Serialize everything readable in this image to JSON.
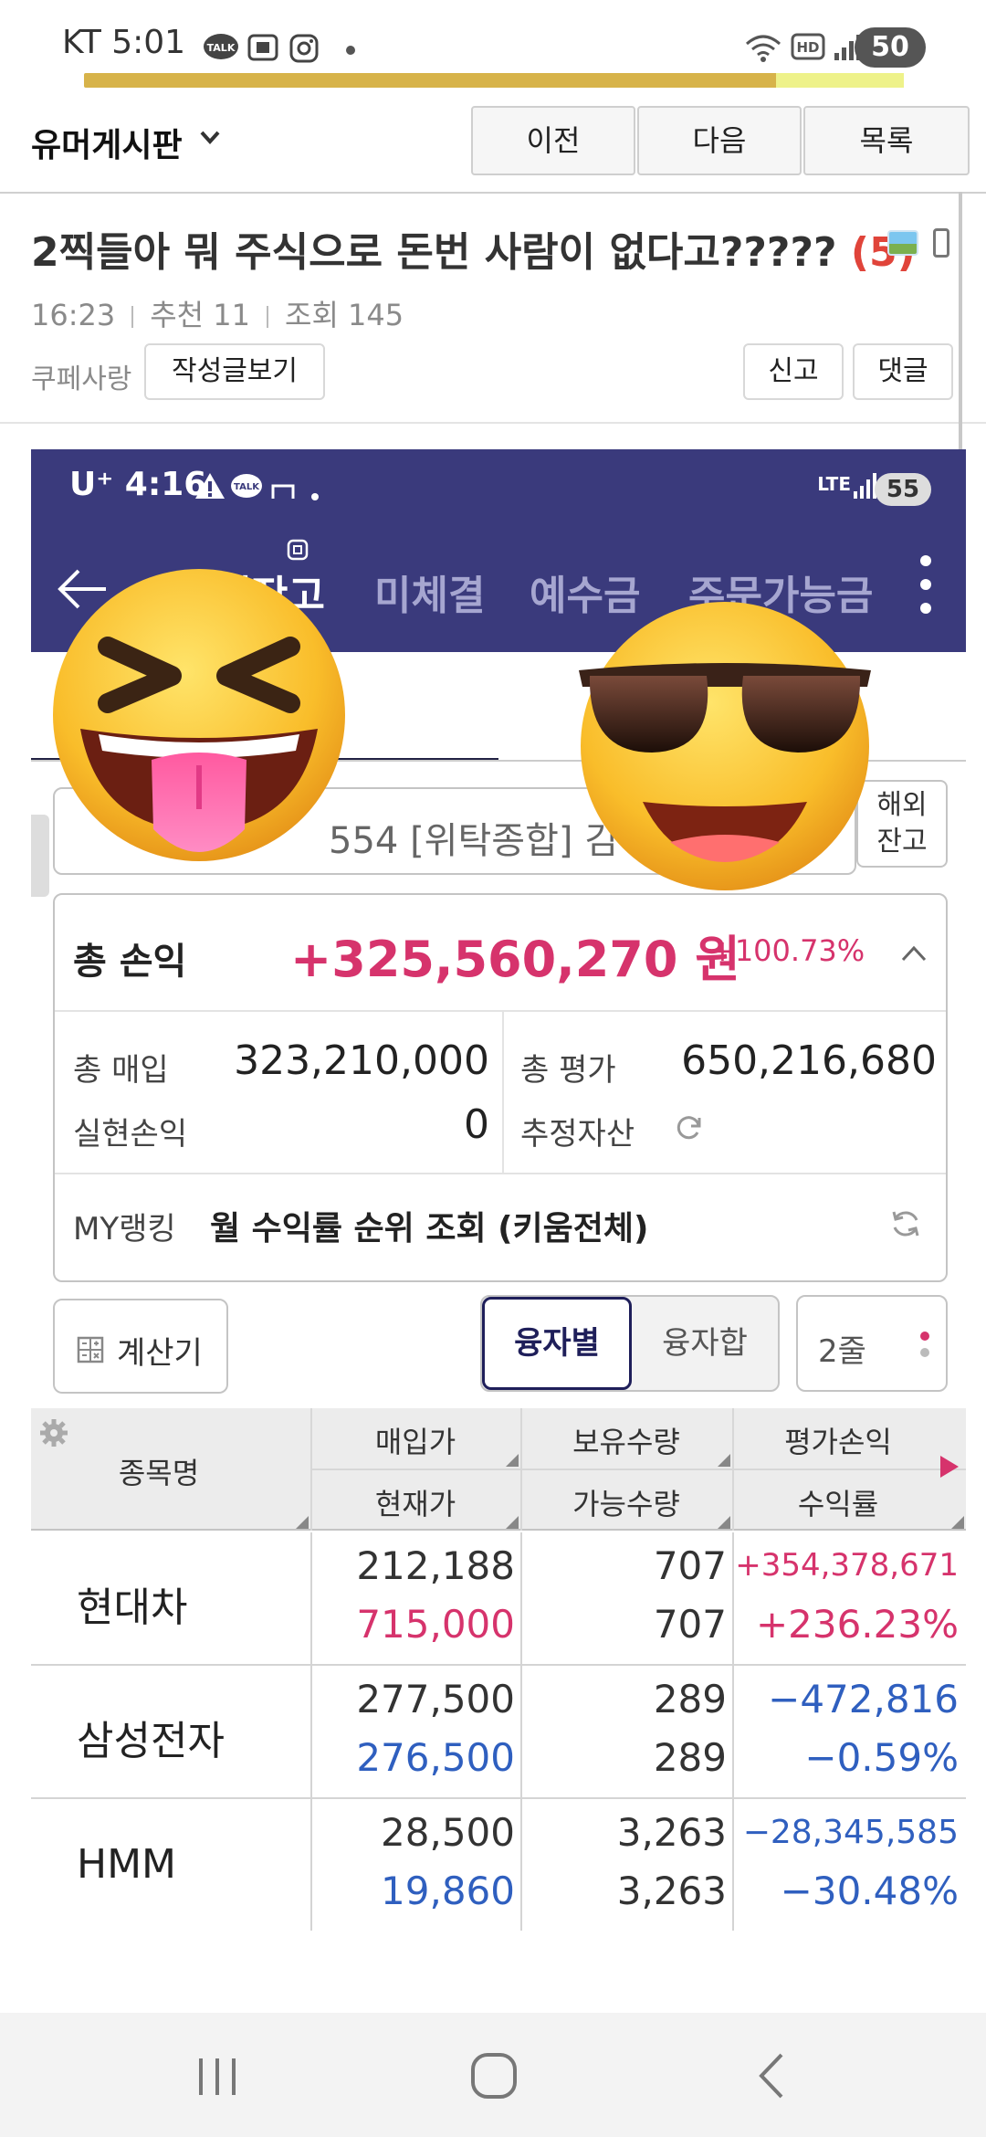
{
  "status_bar": {
    "carrier_time": "KT 5:01",
    "battery": "50"
  },
  "board": {
    "name": "유머게시판",
    "prev_label": "이전",
    "next_label": "다음",
    "list_label": "목록"
  },
  "post": {
    "title": "2찍들아 뭐 주식으로 돈번 사람이 없다고?????",
    "comment_count": "(5)",
    "time": "16:23",
    "likes": "추천 11",
    "views": "조회 145",
    "author": "쿠페사랑",
    "view_posts_label": "작성글보기",
    "report_label": "신고",
    "comment_label": "댓글"
  },
  "screenshot": {
    "status": {
      "carrier_time": "U⁺ 4:16",
      "net": "LTE",
      "battery": "55"
    },
    "tabs": [
      {
        "label": "국내잔고"
      },
      {
        "label": "미체결"
      },
      {
        "label": "예수금"
      },
      {
        "label": "주문가능금"
      }
    ],
    "account": {
      "text": "554 [위탁종합] 김",
      "overseas_label": "해외\n잔고"
    },
    "summary": {
      "total_pl_label": "총 손익",
      "total_pl_value": "+325,560,270 원",
      "total_pl_rate": "+100.73%",
      "purchase_label": "총 매입",
      "purchase_value": "323,210,000",
      "valuation_label": "총 평가",
      "valuation_value": "650,216,680",
      "realized_label": "실현손익",
      "realized_value": "0",
      "estimated_label": "추정자산",
      "ranking_label": "MY랭킹",
      "ranking_text": "월 수익률 순위 조회 (키움전체)"
    },
    "controls": {
      "calculator_label": "계산기",
      "by_loan_label": "융자별",
      "loan_sum_label": "융자합",
      "lines_label": "2줄"
    },
    "table": {
      "headers": {
        "name": "종목명",
        "buy_price": "매입가",
        "current_price": "현재가",
        "holding_qty": "보유수량",
        "available_qty": "가능수량",
        "eval_pl": "평가손익",
        "return_rate": "수익률"
      },
      "rows": [
        {
          "name": "현대차",
          "buy_price": "212,188",
          "current_price": "715,000",
          "holding_qty": "707",
          "available_qty": "707",
          "eval_pl": "+354,378,671",
          "return_rate": "+236.23%",
          "color": "#d6336c"
        },
        {
          "name": "삼성전자",
          "buy_price": "277,500",
          "current_price": "276,500",
          "holding_qty": "289",
          "available_qty": "289",
          "eval_pl": "−472,816",
          "return_rate": "−0.59%",
          "color": "#2f5fbf"
        },
        {
          "name": "HMM",
          "buy_price": "28,500",
          "current_price": "19,860",
          "holding_qty": "3,263",
          "available_qty": "3,263",
          "eval_pl": "−28,345,585",
          "return_rate": "−30.48%",
          "color": "#2f5fbf"
        }
      ]
    }
  },
  "emojis": {
    "left": "squinting-tongue-emoji",
    "right": "sunglasses-emoji"
  },
  "colors": {
    "accent_navy": "#3a3a7c",
    "gain": "#d6336c",
    "loss": "#2f5fbf",
    "comment_count": "#e0443a"
  }
}
